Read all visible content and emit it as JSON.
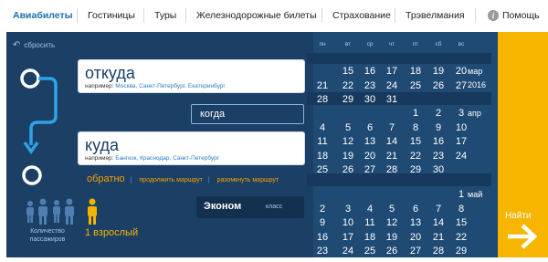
{
  "nav": {
    "items": [
      "Авиабилеты",
      "Гостиницы",
      "Туры",
      "Железнодорожные билеты",
      "Страхование",
      "Трэвелмания"
    ],
    "help_label": "Помощь",
    "active_color": "#1a6fb0"
  },
  "form": {
    "reset_label": "сбросить",
    "from": {
      "label": "откуда",
      "hint_prefix": "например:",
      "hint_examples": "Москва, Санкт-Петербург, Екатеринбург"
    },
    "to": {
      "label": "куда",
      "hint_prefix": "например:",
      "hint_examples": "Бангкок, Краснодар, Санкт-Петербург"
    },
    "when_label": "когда",
    "return_label": "обратно",
    "continue_route": "продолжить маршрут",
    "split_route": "разомкнуть маршрут",
    "passengers_label": "Количество пассажиров",
    "adults_label": "1 взрослый",
    "class_value": "Эконом",
    "class_label": "класс"
  },
  "calendar": {
    "weekdays": [
      "пн",
      "вт",
      "ср",
      "чт",
      "пт",
      "сб",
      "вс"
    ],
    "months": [
      {
        "name": "мар",
        "year": "2016",
        "rows": [
          [
            "",
            "15",
            "16",
            "17",
            "18",
            "19",
            "20"
          ],
          [
            "21",
            "22",
            "23",
            "24",
            "25",
            "26",
            "27"
          ],
          [
            "28",
            "29",
            "30",
            "31",
            "",
            "",
            ""
          ]
        ]
      },
      {
        "name": "апр",
        "year": "",
        "rows": [
          [
            "",
            "",
            "",
            "",
            "1",
            "2",
            "3"
          ],
          [
            "4",
            "5",
            "6",
            "7",
            "8",
            "9",
            "10"
          ],
          [
            "11",
            "12",
            "13",
            "14",
            "15",
            "16",
            "17"
          ],
          [
            "18",
            "19",
            "20",
            "21",
            "22",
            "23",
            "24"
          ],
          [
            "25",
            "26",
            "27",
            "28",
            "29",
            "30",
            ""
          ]
        ]
      },
      {
        "name": "май",
        "year": "",
        "rows": [
          [
            "",
            "",
            "",
            "",
            "",
            "",
            "1"
          ],
          [
            "2",
            "3",
            "4",
            "5",
            "6",
            "7",
            "8"
          ],
          [
            "9",
            "10",
            "11",
            "12",
            "13",
            "14",
            "15"
          ],
          [
            "16",
            "17",
            "18",
            "19",
            "20",
            "21",
            "22"
          ],
          [
            "23",
            "24",
            "25",
            "26",
            "27",
            "28",
            "29"
          ]
        ]
      }
    ]
  },
  "search_label": "Найти",
  "colors": {
    "panel": "#1c3f66",
    "accent": "#f7b500",
    "link": "#f5a100"
  }
}
